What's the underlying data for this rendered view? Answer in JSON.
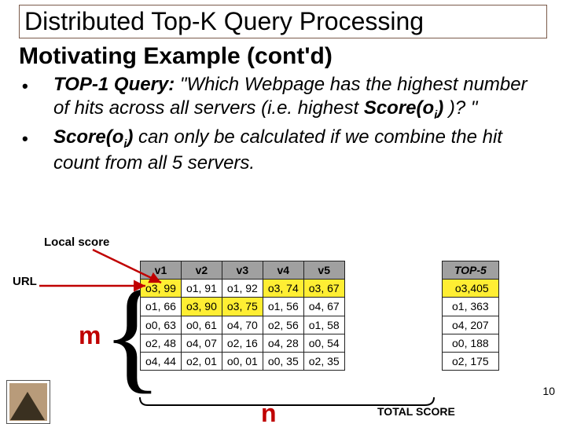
{
  "title": "Distributed Top-K Query Processing",
  "subtitle": "Motivating Example (cont'd)",
  "bullets": {
    "b1_lead": "TOP-1 Query:",
    "b1_rest": " \"Which Webpage has the highest number of hits across all servers (i.e. highest ",
    "b1_score": "Score(o",
    "b1_sub": "i",
    "b1_close": ")",
    "b1_end": " )? \"",
    "b2_score": "Score(o",
    "b2_sub": "i",
    "b2_close": ")",
    "b2_rest": " can only be calculated if we combine the hit count from all 5 servers."
  },
  "labels": {
    "local_score": "Local score",
    "url": "URL",
    "m": "m",
    "n": "n",
    "total_score": "TOTAL SCORE"
  },
  "page_number": "10",
  "v_headers": [
    "v1",
    "v2",
    "v3",
    "v4",
    "v5"
  ],
  "v_rows": [
    [
      "o3, 99",
      "o1, 91",
      "o1, 92",
      "o3, 74",
      "o3, 67"
    ],
    [
      "o1, 66",
      "o3, 90",
      "o3, 75",
      "o1, 56",
      "o4, 67"
    ],
    [
      "o0, 63",
      "o0, 61",
      "o4, 70",
      "o2, 56",
      "o1, 58"
    ],
    [
      "o2, 48",
      "o4, 07",
      "o2, 16",
      "o4, 28",
      "o0, 54"
    ],
    [
      "o4, 44",
      "o2, 01",
      "o0, 01",
      "o0, 35",
      "o2, 35"
    ]
  ],
  "top_header": "TOP-5",
  "top_rows": [
    "o3,405",
    "o1, 363",
    "o4, 207",
    "o0, 188",
    "o2, 175"
  ]
}
